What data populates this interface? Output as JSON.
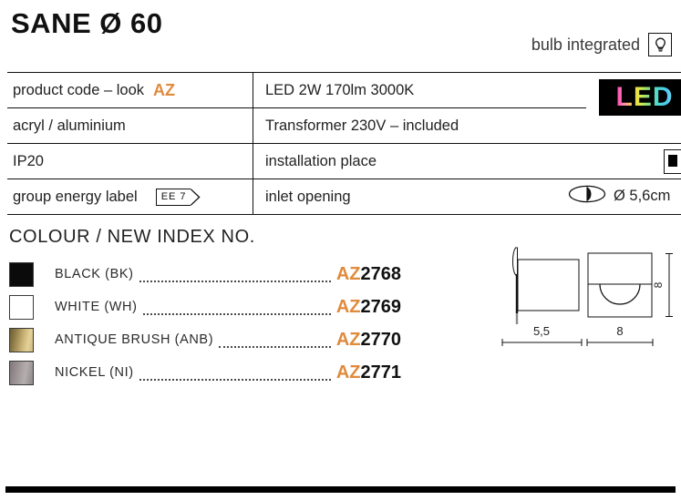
{
  "header": {
    "title": "SANE Ø 60",
    "bulb_label": "bulb integrated",
    "bulb_icon": "lightbulb-icon"
  },
  "spec_table": {
    "rows": [
      {
        "left": "product code – look",
        "left_accent": "AZ",
        "middle": "LED 2W 170lm 3000K",
        "right_icon": "led-logo",
        "right_text": "LED"
      },
      {
        "left": "acryl / aluminium",
        "left_accent": "",
        "middle": "Transformer 230V – included",
        "right_icon": "",
        "right_text": ""
      },
      {
        "left": "IP20",
        "left_accent": "",
        "middle": "installation place",
        "right_icon": "wall-recessed-icon",
        "right_text": ""
      },
      {
        "left": "group energy label",
        "left_accent": "",
        "left_badge": "EE  7",
        "middle": "inlet opening",
        "right_icon": "inlet-ellipse-icon",
        "right_text": "Ø 5,6cm"
      }
    ]
  },
  "colour_section": {
    "heading": "COLOUR / NEW INDEX NO.",
    "code_prefix": "AZ",
    "items": [
      {
        "name": "BLACK (BK)",
        "code_number": "2768",
        "swatch": "#0b0b0b",
        "swatch_kind": "solid"
      },
      {
        "name": "WHITE (WH)",
        "code_number": "2769",
        "swatch": "#ffffff",
        "swatch_kind": "solid"
      },
      {
        "name": "ANTIQUE BRUSH (ANB)",
        "code_number": "2770",
        "swatch": "#b59b5e",
        "swatch_kind": "gradient-gold"
      },
      {
        "name": "NICKEL (NI)",
        "code_number": "2771",
        "swatch": "#9a9597",
        "swatch_kind": "gradient-grey"
      }
    ]
  },
  "technical_drawing": {
    "dim_side_width": "5,5",
    "dim_front_width": "8",
    "dim_height": "8"
  },
  "colors": {
    "accent": "#E08A3C",
    "text": "#222222",
    "rule": "#111111"
  }
}
